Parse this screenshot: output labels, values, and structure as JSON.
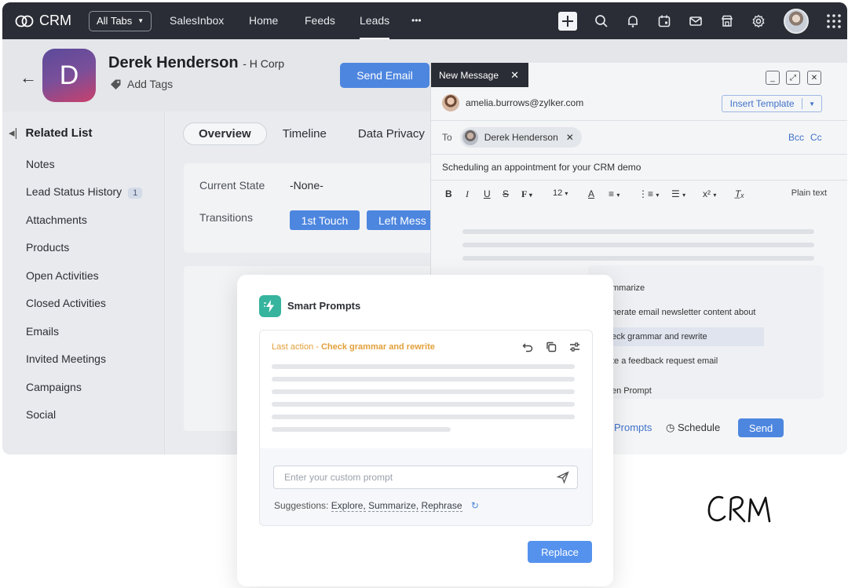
{
  "topbar": {
    "logo_text": "CRM",
    "all_tabs": "All Tabs",
    "nav": [
      "SalesInbox",
      "Home",
      "Feeds",
      "Leads",
      "•••"
    ],
    "active_nav": "Leads"
  },
  "contact": {
    "initial": "D",
    "name": "Derek Henderson",
    "company": "- H Corp",
    "add_tags": "Add Tags",
    "send_email": "Send Email"
  },
  "sidebar": {
    "title": "Related List",
    "items": [
      {
        "label": "Notes"
      },
      {
        "label": "Lead Status History",
        "badge": "1"
      },
      {
        "label": "Attachments"
      },
      {
        "label": "Products"
      },
      {
        "label": "Open Activities"
      },
      {
        "label": "Closed Activities"
      },
      {
        "label": "Emails"
      },
      {
        "label": "Invited Meetings"
      },
      {
        "label": "Campaigns"
      },
      {
        "label": "Social"
      }
    ]
  },
  "main": {
    "tabs": [
      "Overview",
      "Timeline",
      "Data Privacy"
    ],
    "current_state_label": "Current State",
    "current_state_value": "-None-",
    "transitions_label": "Transitions",
    "transitions": [
      "1st Touch",
      "Left Mess"
    ]
  },
  "compose": {
    "tab_title": "New Message",
    "from": "amelia.burrows@zylker.com",
    "insert_template": "Insert Template",
    "to_label": "To",
    "to_chip": "Derek Henderson",
    "bcc": "Bcc",
    "cc": "Cc",
    "subject": "Scheduling an appointment for your CRM demo",
    "font_size": "12",
    "plain_text": "Plain text",
    "suggestions": [
      "mmarize",
      "nerate email newsletter content about",
      "eck grammar and rewrite",
      "te a feedback request email",
      "en Prompt"
    ],
    "prompts_link": "Prompts",
    "schedule": "Schedule",
    "send": "Send"
  },
  "smart_prompts": {
    "title": "Smart Prompts",
    "last_action_prefix": "Last action -",
    "last_action": "Check grammar and rewrite",
    "input_placeholder": "Enter your custom prompt",
    "suggestions_label": "Suggestions:",
    "suggestions": [
      "Explore,",
      "Summarize,",
      "Rephrase"
    ],
    "replace": "Replace"
  },
  "colors": {
    "topbar": "#2a2d35",
    "accent": "#4d86df",
    "smart_prompt_icon": "#36b49e",
    "last_action": "#e2a03a"
  }
}
